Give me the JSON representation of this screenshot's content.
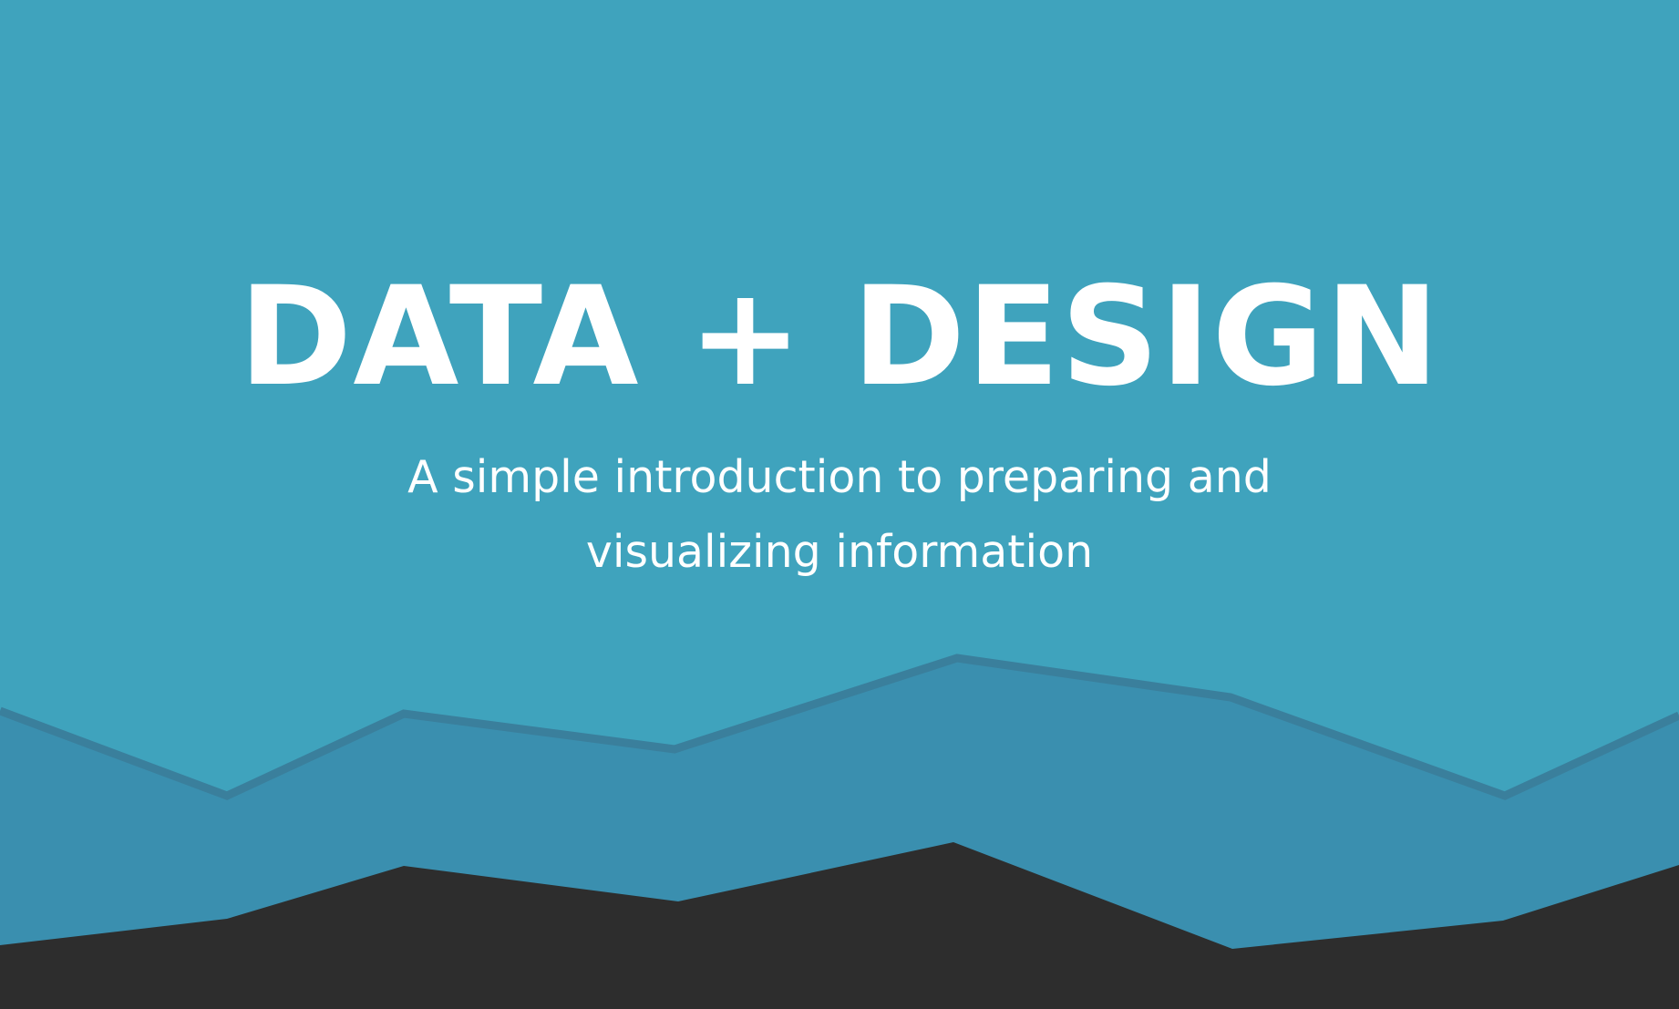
{
  "cover": {
    "title": "DATA + DESIGN",
    "subtitle": "A simple introduction to preparing and visualizing information"
  },
  "colors": {
    "background": "#3fa3bd",
    "mid_layer": "#3a8faf",
    "mid_layer_edge": "#3a7f9c",
    "dark_layer": "#2d2d2d",
    "text": "#ffffff"
  }
}
